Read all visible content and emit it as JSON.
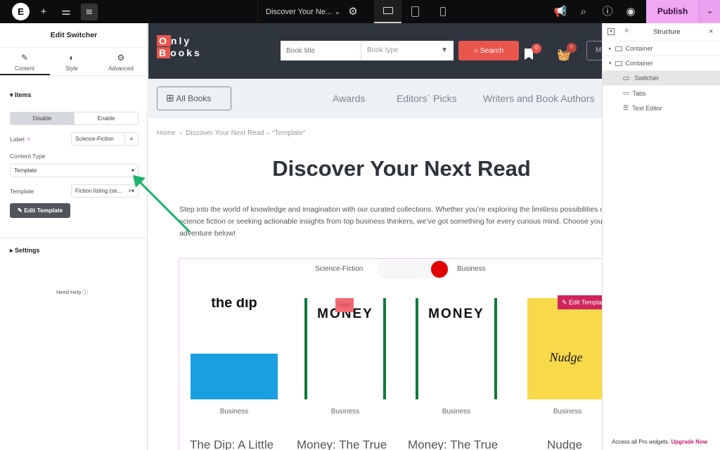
{
  "topbar": {
    "page_title": "Discover Your Ne...",
    "publish": "Publish"
  },
  "panel": {
    "title": "Edit Switcher",
    "tabs": [
      {
        "label": "Content"
      },
      {
        "label": "Style"
      },
      {
        "label": "Advanced"
      }
    ],
    "items_section": "Items",
    "toggle": {
      "disable": "Disable",
      "enable": "Enable",
      "selected": "Disable"
    },
    "label_label": "Label",
    "label_value": "Science-Fiction",
    "content_type_label": "Content Type",
    "content_type_value": "Template",
    "template_label": "Template",
    "template_value": "Fiction listing (se...",
    "edit_template": "Edit Template",
    "settings_section": "Settings",
    "need_help": "Need Help"
  },
  "site": {
    "logo_o": "O",
    "logo_nly": "nly",
    "logo_b": "B",
    "logo_ooks": "ooks",
    "search_placeholder": "Book title",
    "book_type_placeholder": "Book type",
    "search_button": "Search",
    "bookmark_count": "0",
    "cart_count": "0",
    "more_btn": "M",
    "nav": {
      "all_books": "All Books",
      "links": [
        "Awards",
        "Editors` Picks",
        "Writers and Book Authors"
      ]
    },
    "breadcrumb": {
      "home": "Home",
      "current": "Discover Your Next Read – “Template”"
    },
    "heading": "Discover Your Next Read",
    "intro": "Step into the world of knowledge and imagination with our curated collections. Whether you’re exploring the limitless possibilities of science fiction or seeking actionable insights from top business thinkers, we’ve got something for every curious mind. Choose your next adventure below!",
    "switcher": {
      "left": "Science-Fiction",
      "right": "Business",
      "active": "Business"
    },
    "edit_template_badge": "Edit Template",
    "books": [
      {
        "category": "Business",
        "title": "The Dip: A Little",
        "cover": "the dip",
        "sale": ""
      },
      {
        "category": "Business",
        "title": "Money: The True",
        "cover": "MONEY",
        "sale": "Sale!"
      },
      {
        "category": "Business",
        "title": "Money: The True",
        "cover": "MONEY",
        "sale": ""
      },
      {
        "category": "Business",
        "title": "Nudge",
        "cover": "Nudge",
        "sale": ""
      }
    ]
  },
  "structure": {
    "title": "Structure",
    "items": [
      {
        "label": "Container"
      },
      {
        "label": "Container"
      },
      {
        "label": "Switcher"
      },
      {
        "label": "Tabs"
      },
      {
        "label": "Text Editor"
      }
    ],
    "promo": "Access all Pro widgets.",
    "upgrade": "Upgrade Now"
  },
  "colors": {
    "accent": "#e8564d",
    "publish_bg": "#f0a8f5",
    "arrow": "#1db36b",
    "switch_knob": "#e00000"
  }
}
